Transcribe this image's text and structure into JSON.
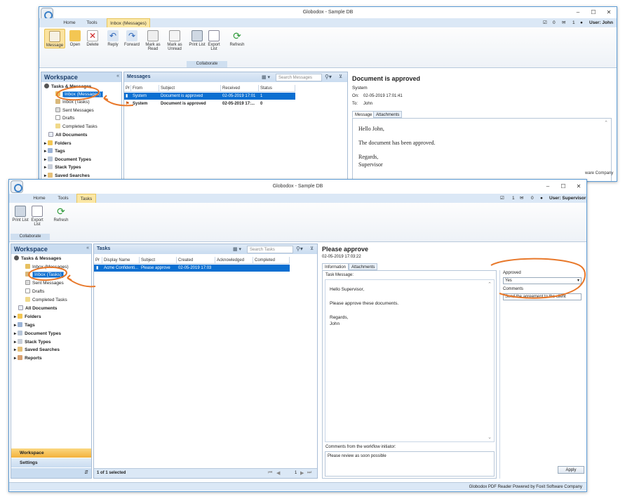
{
  "back_window": {
    "title": "Globodox - Sample DB",
    "tabs": [
      "Home",
      "Tools",
      "Inbox (Messages)"
    ],
    "status_counts": {
      "a": "0",
      "b": "1"
    },
    "user": "User: John",
    "ribbon": {
      "buttons": [
        "Message",
        "Open",
        "Delete",
        "Reply",
        "Forward",
        "Mark as Read",
        "Mark as Unread",
        "Print List",
        "Export List",
        "Refresh"
      ],
      "group_collaborate": "Collaborate"
    },
    "workspace": {
      "title": "Workspace",
      "tree": [
        "Tasks & Messages",
        "Inbox (Messages)",
        "Inbox (Tasks)",
        "Sent Messages",
        "Drafts",
        "Completed Tasks",
        "All Documents",
        "Folders",
        "Tags",
        "Document Types",
        "Stack Types",
        "Saved Searches"
      ]
    },
    "messages": {
      "title": "Messages",
      "search_placeholder": "Search Messages",
      "columns": [
        "Pr",
        "From",
        "Subject",
        "Received",
        "Status"
      ],
      "rows": [
        {
          "from": "System",
          "subject": "Document is approved",
          "received": "02-05-2019 17:01",
          "status": "1"
        },
        {
          "from": "System",
          "subject": "Document is approved",
          "received": "02-05-2019 17:...",
          "status": "0"
        }
      ]
    },
    "preview": {
      "title": "Document is approved",
      "from": "System",
      "on_label": "On:",
      "on_value": "02-05-2019 17:01:41",
      "to_label": "To:",
      "to_value": "John",
      "tabs": [
        "Message",
        "Attachments"
      ],
      "body": [
        "Hello John,",
        "The document has been approved.",
        "Regards,",
        "Supervisor"
      ]
    },
    "footer_fragment": "ware Company"
  },
  "front_window": {
    "title": "Globodox - Sample DB",
    "tabs": [
      "Home",
      "Tools",
      "Tasks"
    ],
    "status_counts": {
      "a": "1",
      "b": "0"
    },
    "user": "User: Supervisor",
    "ribbon": {
      "buttons": [
        "Print List",
        "Export List",
        "Refresh"
      ],
      "group_collaborate": "Collaborate"
    },
    "workspace": {
      "title": "Workspace",
      "tree": [
        "Tasks & Messages",
        "Inbox (Messages)",
        "Inbox (Tasks)",
        "Sent Messages",
        "Drafts",
        "Completed Tasks",
        "All Documents",
        "Folders",
        "Tags",
        "Document Types",
        "Stack Types",
        "Saved Searches",
        "Reports"
      ],
      "nav": [
        "Workspace",
        "Settings"
      ]
    },
    "tasks": {
      "title": "Tasks",
      "search_placeholder": "Search Tasks",
      "columns": [
        "Pr",
        "Display Name",
        "Subject",
        "Created",
        "Acknowledged",
        "Completed"
      ],
      "rows": [
        {
          "display_name": "Acme Confidenti...",
          "subject": "Please approve",
          "created": "02-05-2019 17:03"
        }
      ],
      "footer": "1 of 1 selected",
      "page": "1"
    },
    "preview": {
      "title": "Please approve",
      "date": "02-05-2019 17:03:22",
      "tabs": [
        "Information",
        "Attachments"
      ],
      "task_message_label": "Task Message:",
      "body": [
        "Hello Supervisor,",
        "Please approve these documents.",
        "Regards,",
        "John"
      ],
      "comments_label": "Comments from the workflow initiator:",
      "comments_value": "Please review as soon possible",
      "approved_label": "Approved",
      "approved_value": "Yes",
      "comments2_label": "Comments",
      "comments2_value": "Send the agreement to the client",
      "apply": "Apply"
    },
    "status_bar": "Globodox PDF Reader Powered by Foxit Software Company"
  },
  "colors": {
    "accent": "#0b6fd1",
    "annotation": "#e8782a",
    "tab_active": "#fbe7a4"
  }
}
